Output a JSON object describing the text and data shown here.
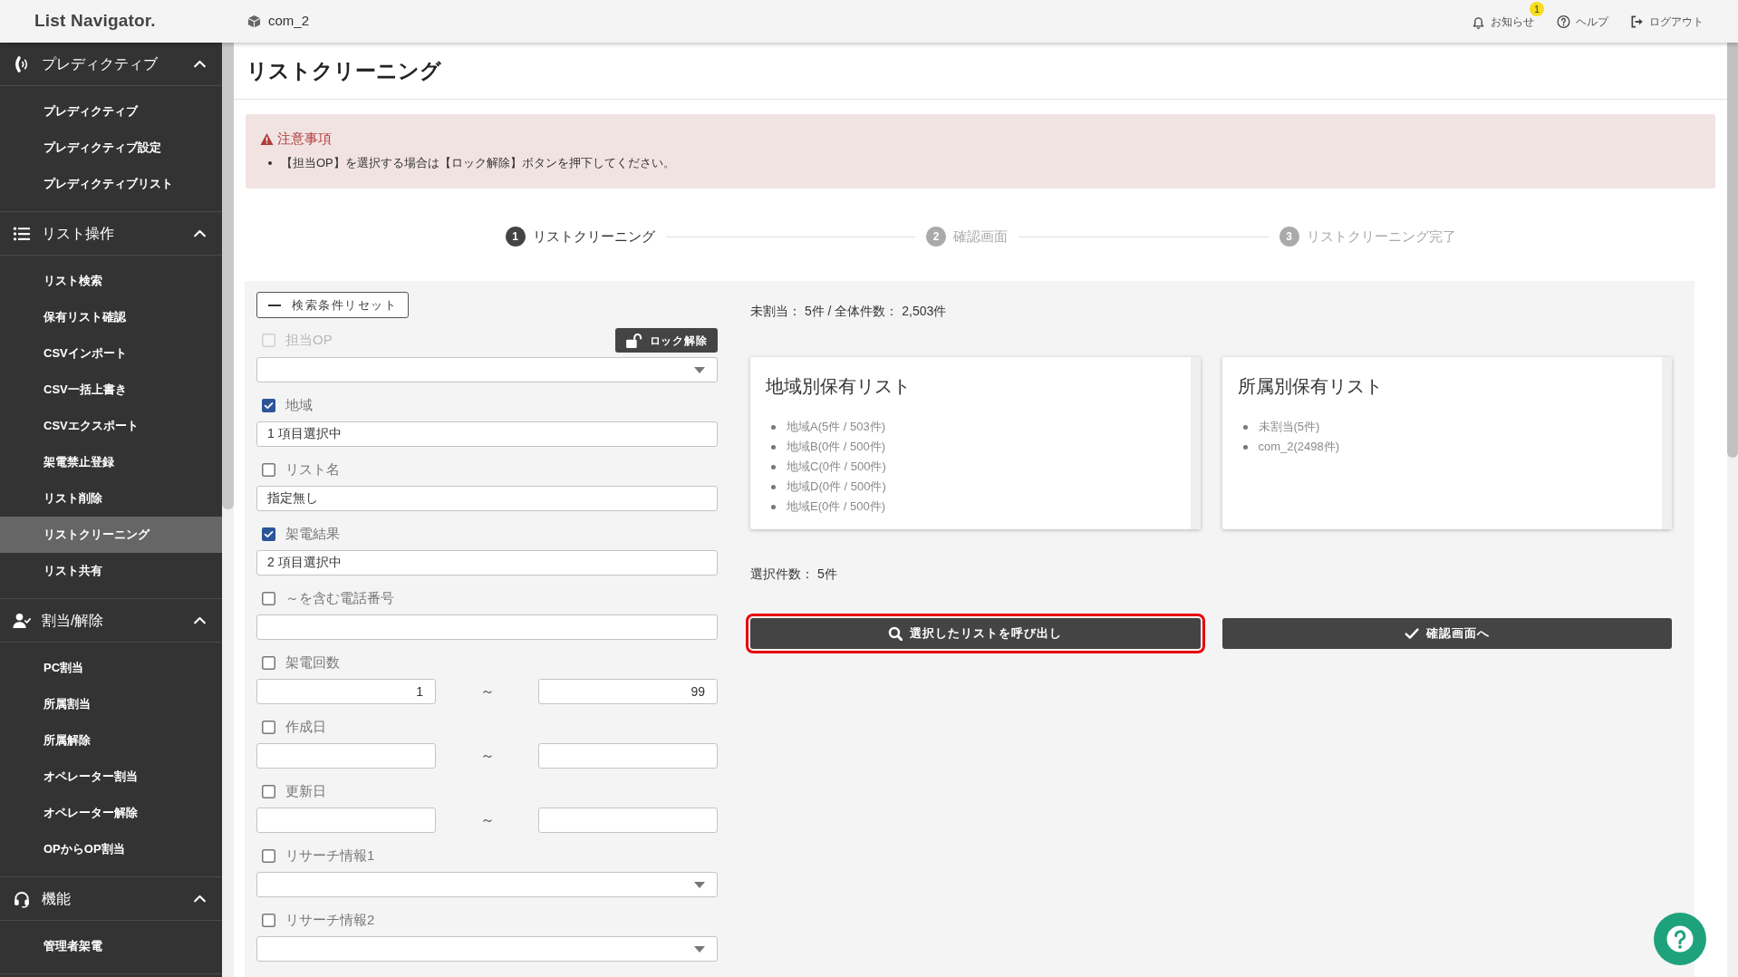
{
  "topbar": {
    "logo": "List Navigator.",
    "tenant": "com_2",
    "links": [
      {
        "kind": "notice",
        "label": "お知らせ",
        "badge": "1"
      },
      {
        "kind": "help",
        "label": "ヘルプ"
      },
      {
        "kind": "logout",
        "label": "ログアウト"
      }
    ]
  },
  "sidebar": {
    "sections": [
      {
        "kind": "predictive",
        "title": "プレディクティブ",
        "expanded": true,
        "items": [
          {
            "label": "プレディクティブ",
            "selected": false
          },
          {
            "label": "プレディクティブ設定",
            "selected": false
          },
          {
            "label": "プレディクティブリスト",
            "selected": false
          }
        ]
      },
      {
        "kind": "list",
        "title": "リスト操作",
        "expanded": true,
        "items": [
          {
            "label": "リスト検索",
            "selected": false
          },
          {
            "label": "保有リスト確認",
            "selected": false
          },
          {
            "label": "CSVインポート",
            "selected": false
          },
          {
            "label": "CSV一括上書き",
            "selected": false
          },
          {
            "label": "CSVエクスポート",
            "selected": false
          },
          {
            "label": "架電禁止登録",
            "selected": false
          },
          {
            "label": "リスト削除",
            "selected": false
          },
          {
            "label": "リストクリーニング",
            "selected": true
          },
          {
            "label": "リスト共有",
            "selected": false
          }
        ]
      },
      {
        "kind": "assign",
        "title": "割当/解除",
        "expanded": true,
        "items": [
          {
            "label": "PC割当",
            "selected": false
          },
          {
            "label": "所属割当",
            "selected": false
          },
          {
            "label": "所属解除",
            "selected": false
          },
          {
            "label": "オペレーター割当",
            "selected": false
          },
          {
            "label": "オペレーター解除",
            "selected": false
          },
          {
            "label": "OPからOP割当",
            "selected": false
          }
        ]
      },
      {
        "kind": "function",
        "title": "機能",
        "expanded": true,
        "items": [
          {
            "label": "管理者架電",
            "selected": false
          }
        ]
      }
    ]
  },
  "page": {
    "title": "リストクリーニング"
  },
  "notice": {
    "title": "注意事項",
    "items": [
      "【担当OP】を選択する場合は【ロック解除】ボタンを押下してください。"
    ]
  },
  "steps": [
    {
      "number": "1",
      "label": "リストクリーニング",
      "active": true
    },
    {
      "number": "2",
      "label": "確認画面",
      "active": false
    },
    {
      "number": "3",
      "label": "リストクリーニング完了",
      "active": false
    }
  ],
  "filters": {
    "reset_button": "検索条件リセット",
    "fields": [
      {
        "kind": "select",
        "label": "担当OP",
        "checked": false,
        "disabled": true,
        "lock_button": "ロック解除"
      },
      {
        "kind": "text",
        "label": "地域",
        "checked": true,
        "disabled": false,
        "value": "1 項目選択中"
      },
      {
        "kind": "text",
        "label": "リスト名",
        "checked": false,
        "disabled": false,
        "value": "指定無し"
      },
      {
        "kind": "text",
        "label": "架電結果",
        "checked": true,
        "disabled": false,
        "value": "2 項目選択中"
      },
      {
        "kind": "text",
        "label": "～を含む電話番号",
        "checked": false,
        "disabled": false
      },
      {
        "kind": "range",
        "label": "架電回数",
        "checked": false,
        "disabled": false,
        "from": "1",
        "to": "99",
        "separator": "～"
      },
      {
        "kind": "range",
        "label": "作成日",
        "checked": false,
        "disabled": false,
        "separator": "～"
      },
      {
        "kind": "range",
        "label": "更新日",
        "checked": false,
        "disabled": false,
        "separator": "～"
      },
      {
        "kind": "select",
        "label": "リサーチ情報1",
        "checked": false,
        "disabled": false
      },
      {
        "kind": "select",
        "label": "リサーチ情報2",
        "checked": false,
        "disabled": false
      }
    ]
  },
  "summary": {
    "counts": "未割当： 5件 / 全体件数： 2,503件",
    "selected_count": "選択件数： 5件"
  },
  "cards": [
    {
      "title": "地域別保有リスト",
      "items": [
        "地域A(5件 / 503件)",
        "地域B(0件 / 500件)",
        "地域C(0件 / 500件)",
        "地域D(0件 / 500件)",
        "地域E(0件 / 500件)"
      ]
    },
    {
      "title": "所属別保有リスト",
      "items": [
        "未割当(5件)",
        "com_2(2498件)"
      ]
    }
  ],
  "actions": [
    {
      "kind": "search",
      "label": "選択したリストを呼び出し",
      "highlighted": true
    },
    {
      "kind": "confirm",
      "label": "確認画面へ",
      "highlighted": false
    }
  ]
}
